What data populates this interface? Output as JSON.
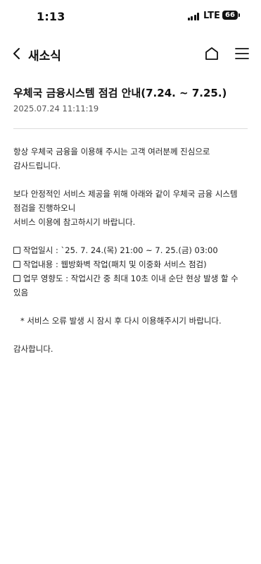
{
  "status_bar": {
    "time": "1:13",
    "network": "LTE",
    "battery": "66"
  },
  "nav": {
    "title": "새소식"
  },
  "article": {
    "title": "우체국 금융시스템 점검 안내(7.24. ~ 7.25.)",
    "date": "2025.07.24 11:11:19",
    "intro_1": "항상 우체국 금융을 이용해 주시는 고객 여러분께 진심으로",
    "intro_2": "감사드립니다.",
    "body_1": "보다 안정적인 서비스 제공을 위해 아래와 같이 우체국 금융 시스템",
    "body_2": "점검을 진행하오니",
    "body_3": "서비스 이용에 참고하시기 바랍니다.",
    "item_1": "작업일시 : `25. 7. 24.(목) 21:00 ~ 7. 25.(금) 03:00",
    "item_2": "작업내용 : 웹방화벽 작업(패치 및 이중화 서비스 점검)",
    "item_3a": "업무 영향도 : 작업시간 중 최대 10초 이내 순단 현상 발생 할 수",
    "item_3b": "있음",
    "note": "* 서비스 오류 발생 시 잠시 후 다시 이용해주시기 바랍니다.",
    "closing": "감사합니다."
  }
}
